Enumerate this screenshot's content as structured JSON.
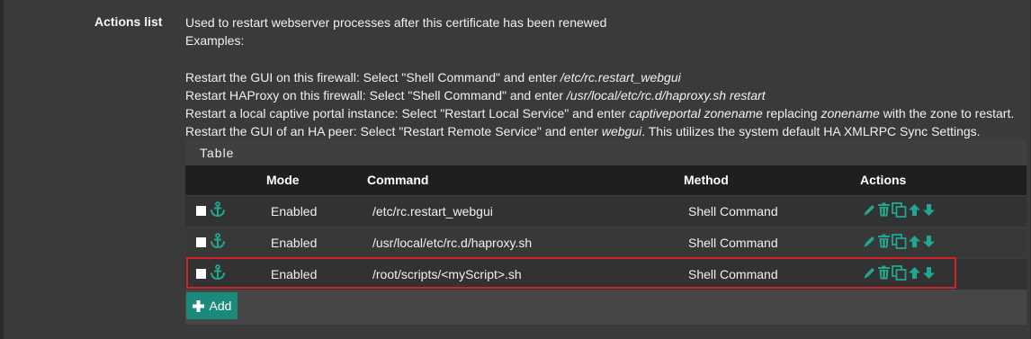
{
  "field": {
    "label": "Actions list"
  },
  "help": {
    "line1": "Used to restart webserver processes after this certificate has been renewed",
    "line2": "Examples:",
    "ex1_prefix": "Restart the GUI on this firewall: Select \"Shell Command\" and enter ",
    "ex1_cmd": "/etc/rc.restart_webgui",
    "ex2_prefix": "Restart HAProxy on this firewall: Select \"Shell Command\" and enter ",
    "ex2_cmd": "/usr/local/etc/rc.d/haproxy.sh restart",
    "ex3_prefix": "Restart a local captive portal instance: Select \"Restart Local Service\" and enter ",
    "ex3_cmd": "captiveportal zonename",
    "ex3_mid": " replacing ",
    "ex3_var": "zonename",
    "ex3_suffix": " with the zone to restart.",
    "ex4_prefix": "Restart the GUI of an HA peer: Select \"Restart Remote Service\" and enter ",
    "ex4_cmd": "webgui",
    "ex4_suffix": ". This utilizes the system default HA XMLRPC Sync Settings."
  },
  "table": {
    "title": "Table",
    "headers": {
      "select": "",
      "mode": "Mode",
      "command": "Command",
      "method": "Method",
      "actions": "Actions"
    },
    "rows": [
      {
        "mode": "Enabled",
        "command": "/etc/rc.restart_webgui",
        "method": "Shell Command"
      },
      {
        "mode": "Enabled",
        "command": "/usr/local/etc/rc.d/haproxy.sh",
        "method": "Shell Command"
      },
      {
        "mode": "Enabled",
        "command": "/root/scripts/<myScript>.sh",
        "method": "Shell Command"
      }
    ]
  },
  "add_button": {
    "label": "Add"
  },
  "colors": {
    "accent": "#1b8a7a",
    "icon": "#21a68f",
    "highlight": "#d2232a"
  },
  "icons": [
    "anchor-icon",
    "pencil-icon",
    "trash-icon",
    "copy-icon",
    "arrow-up-icon",
    "arrow-down-icon",
    "plus-icon"
  ]
}
